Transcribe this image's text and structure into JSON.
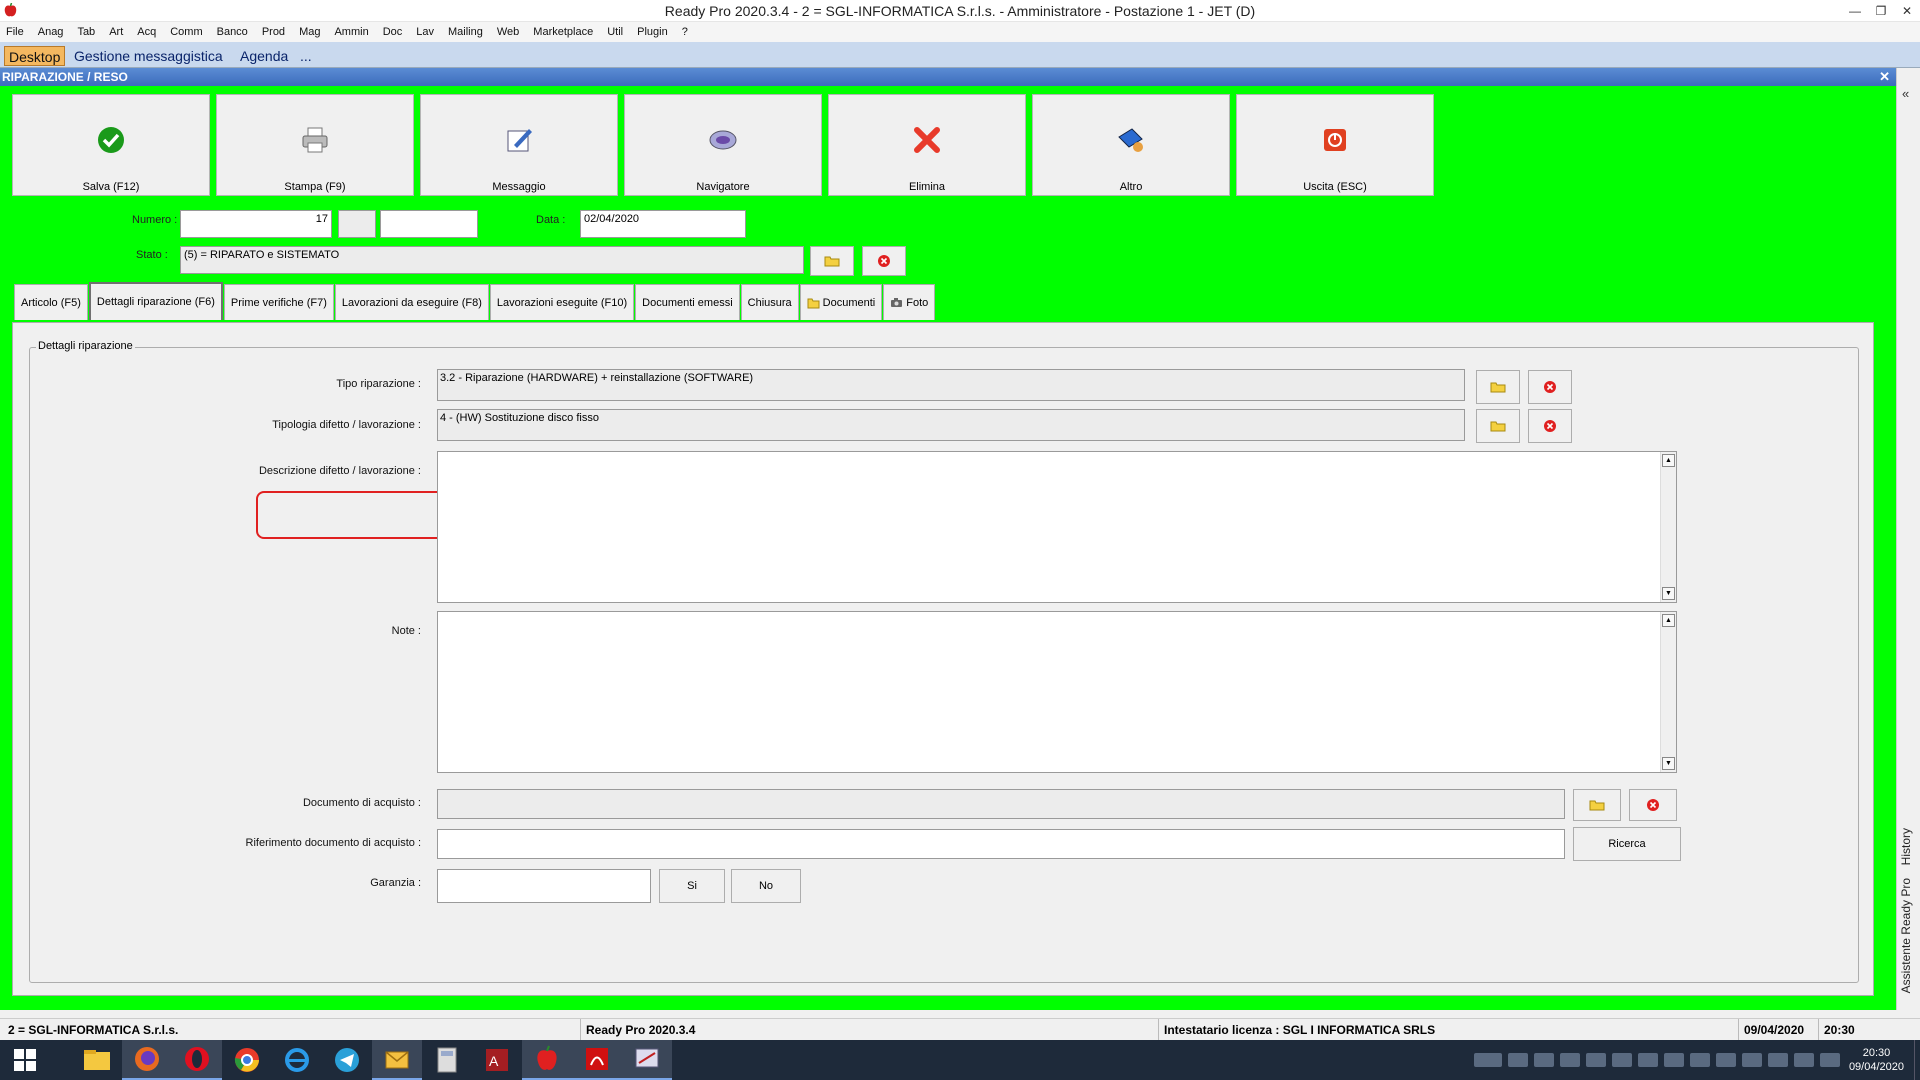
{
  "window": {
    "title": "Ready Pro 2020.3.4 - 2 = SGL-INFORMATICA S.r.l.s. - Amministratore - Postazione 1 - JET (D)"
  },
  "menu": [
    "File",
    "Anag",
    "Tab",
    "Art",
    "Acq",
    "Comm",
    "Banco",
    "Prod",
    "Mag",
    "Ammin",
    "Doc",
    "Lav",
    "Mailing",
    "Web",
    "Marketplace",
    "Util",
    "Plugin",
    "?"
  ],
  "top_tabs": [
    {
      "label": "Desktop",
      "active": true
    },
    {
      "label": "Gestione messaggistica",
      "active": false
    },
    {
      "label": "Agenda",
      "active": false
    },
    {
      "label": "...",
      "active": false
    }
  ],
  "panel": {
    "title": "RIPARAZIONE / RESO"
  },
  "rail": {
    "history": "History",
    "assistant": "Assistente Ready Pro"
  },
  "toolbar": [
    {
      "label": "Salva (F12)",
      "icon": "check-icon"
    },
    {
      "label": "Stampa (F9)",
      "icon": "printer-icon"
    },
    {
      "label": "Messaggio",
      "icon": "message-icon"
    },
    {
      "label": "Navigatore",
      "icon": "navigator-icon"
    },
    {
      "label": "Elimina",
      "icon": "delete-icon"
    },
    {
      "label": "Altro",
      "icon": "other-icon"
    },
    {
      "label": "Uscita (ESC)",
      "icon": "exit-icon"
    }
  ],
  "header": {
    "numero_label": "Numero :",
    "numero_value": "17",
    "data_label": "Data :",
    "data_value": "02/04/2020",
    "stato_label": "Stato :",
    "stato_value": "(5) = RIPARATO e SISTEMATO"
  },
  "form_tabs": [
    {
      "label": "Articolo (F5)",
      "active": false
    },
    {
      "label": "Dettagli riparazione (F6)",
      "active": true
    },
    {
      "label": "Prime verifiche (F7)",
      "active": false
    },
    {
      "label": "Lavorazioni da eseguire (F8)",
      "active": false
    },
    {
      "label": "Lavorazioni eseguite  (F10)",
      "active": false
    },
    {
      "label": "Documenti emessi",
      "active": false
    },
    {
      "label": "Chiusura",
      "active": false
    },
    {
      "label": "Documenti",
      "active": false
    },
    {
      "label": "Foto",
      "active": false
    }
  ],
  "details": {
    "group_title": "Dettagli riparazione",
    "tipo_label": "Tipo riparazione :",
    "tipo_value": "3.2 - Riparazione (HARDWARE) + reinstallazione (SOFTWARE)",
    "tipologia_label": "Tipologia difetto / lavorazione :",
    "tipologia_value": "4 - (HW) Sostituzione disco fisso",
    "descrizione_label": "Descrizione difetto / lavorazione :",
    "descrizione_value": "",
    "note_label": "Note :",
    "note_value": "",
    "doc_acquisto_label": "Documento di acquisto :",
    "doc_acquisto_value": "",
    "rif_doc_label": "Riferimento documento di acquisto :",
    "rif_doc_value": "",
    "ricerca_label": "Ricerca",
    "garanzia_label": "Garanzia :",
    "garanzia_value": "",
    "si_label": "Si",
    "no_label": "No"
  },
  "status": {
    "company": "2 = SGL-INFORMATICA S.r.l.s.",
    "version": "Ready Pro 2020.3.4",
    "license": "Intestatario licenza : SGL I INFORMATICA SRLS",
    "date": "09/04/2020",
    "time": "20:30"
  },
  "taskbar": {
    "time": "20:30",
    "date": "09/04/2020"
  },
  "colors": {
    "background_green": "#00ff00",
    "highlight_red": "#e02020",
    "active_tab": "#f4b860"
  }
}
